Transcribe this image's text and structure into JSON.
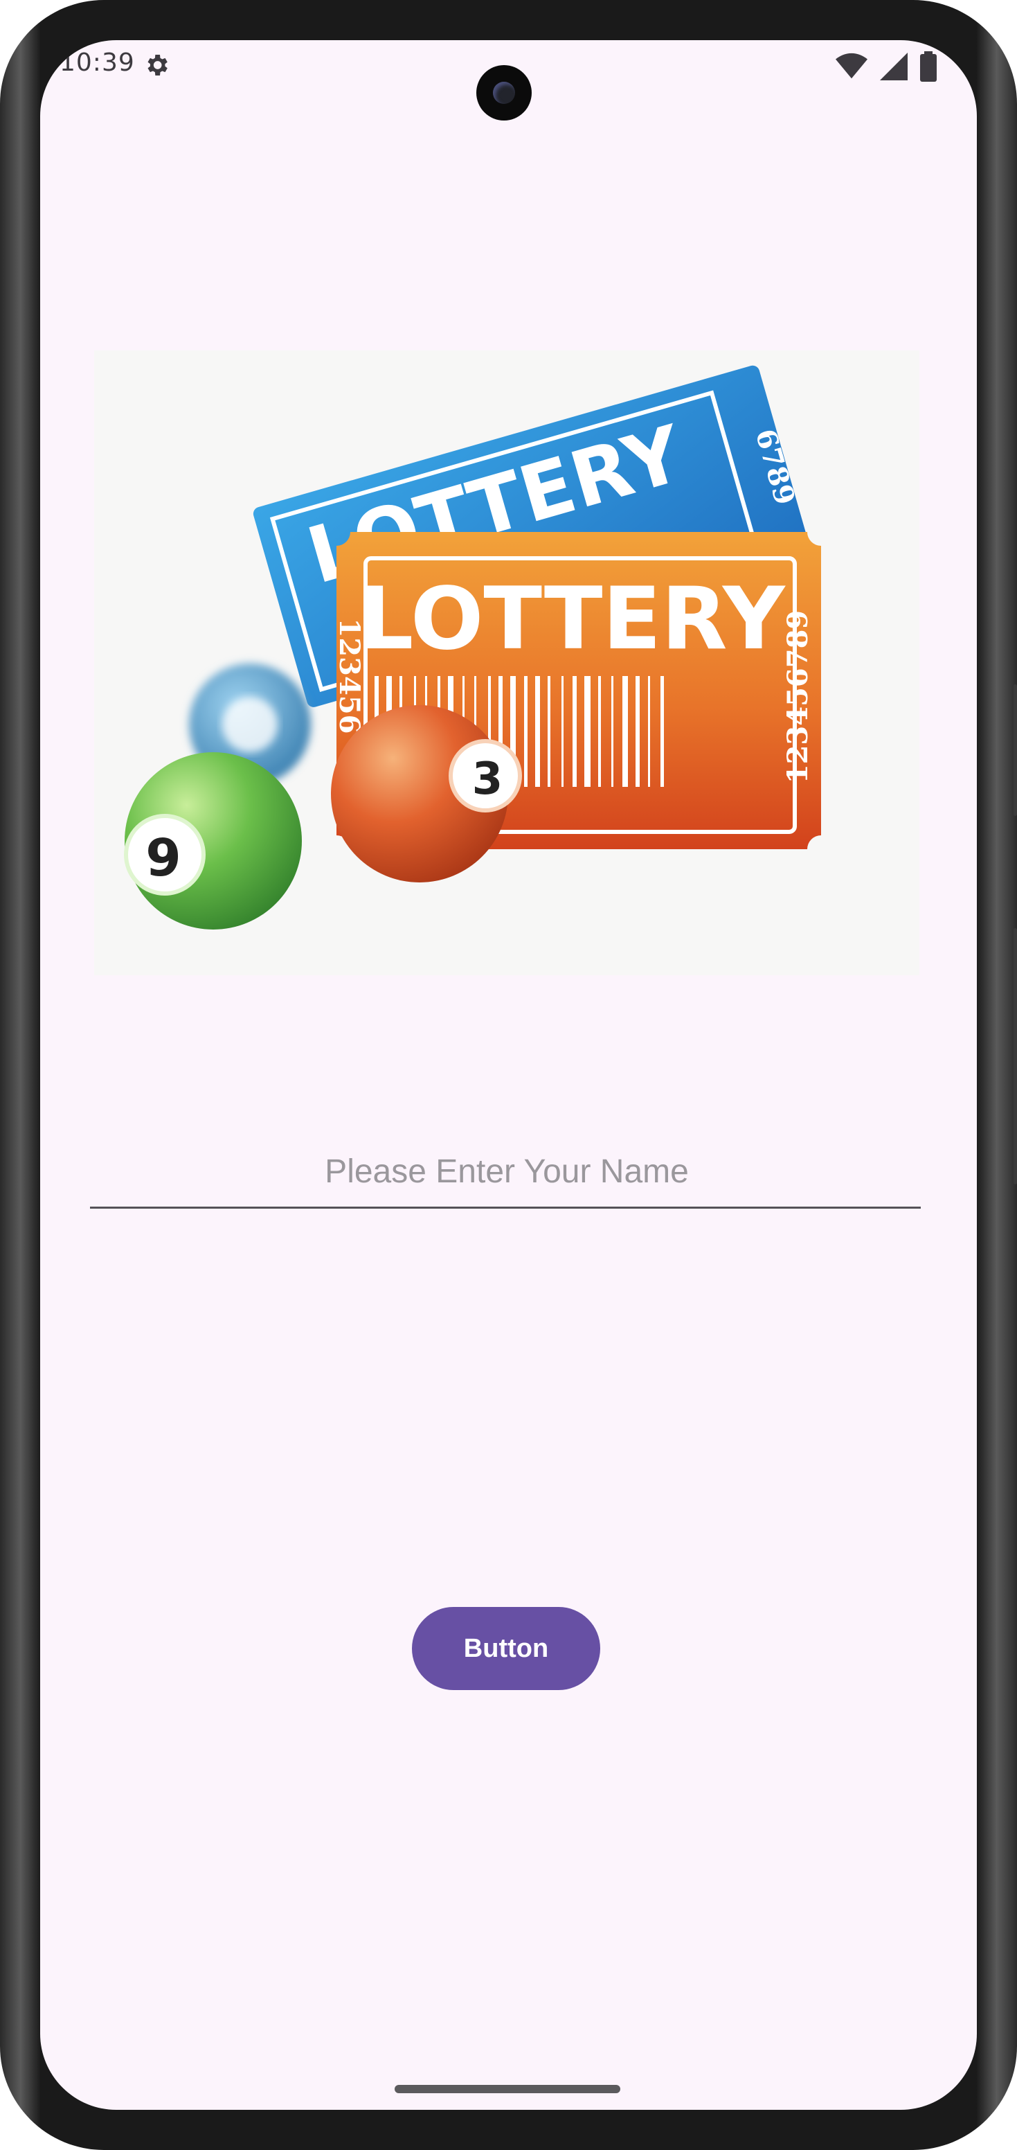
{
  "status_bar": {
    "time": "10:39"
  },
  "hero_image": {
    "ticket_back_text": "LOTTERY",
    "ticket_back_serial": "6789",
    "ticket_front_text": "LOTTERY",
    "ticket_front_serial_left": "123456",
    "ticket_front_serial_right": "123456789",
    "ball_green_number": "9",
    "ball_orange_number": "3"
  },
  "form": {
    "name_placeholder": "Please Enter Your Name",
    "name_value": ""
  },
  "action_button": {
    "label": "Button"
  },
  "colors": {
    "screen_background": "#fcf4fc",
    "button_background": "#6750a4",
    "ticket_blue": "#2a8fd4",
    "ticket_orange": "#e8742a",
    "ball_green": "#6bbf4a",
    "ball_orange": "#e2622e"
  }
}
